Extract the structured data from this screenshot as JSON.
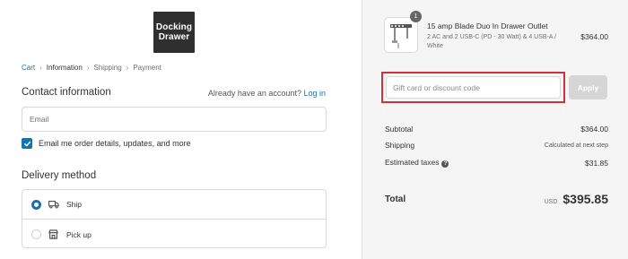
{
  "logo": {
    "line1": "Docking",
    "line2": "Drawer"
  },
  "breadcrumb": [
    "Cart",
    "Information",
    "Shipping",
    "Payment"
  ],
  "contact": {
    "title": "Contact information",
    "account_prompt": "Already have an account?",
    "login_link": "Log in",
    "email_placeholder": "Email",
    "newsletter_label": "Email me order details, updates, and more",
    "newsletter_checked": true
  },
  "delivery": {
    "title": "Delivery method",
    "options": [
      {
        "label": "Ship",
        "icon": "truck-icon",
        "selected": true
      },
      {
        "label": "Pick up",
        "icon": "store-icon",
        "selected": false
      }
    ]
  },
  "order": {
    "item": {
      "quantity": "1",
      "title": "15 amp Blade Duo In Drawer Outlet",
      "variant": "2 AC and 2 USB-C (PD - 30 Watt) & 4 USB-A / White",
      "price": "$364.00"
    },
    "discount_placeholder": "Gift card or discount code",
    "apply_label": "Apply",
    "summary": {
      "subtotal_label": "Subtotal",
      "subtotal_value": "$364.00",
      "shipping_label": "Shipping",
      "shipping_value": "Calculated at next step",
      "taxes_label": "Estimated taxes",
      "taxes_value": "$31.85"
    },
    "total": {
      "label": "Total",
      "currency": "USD",
      "amount": "$395.85"
    }
  },
  "colors": {
    "accent": "#1773b0",
    "highlight": "#d0313c",
    "panel_bg": "#f5f5f5"
  }
}
